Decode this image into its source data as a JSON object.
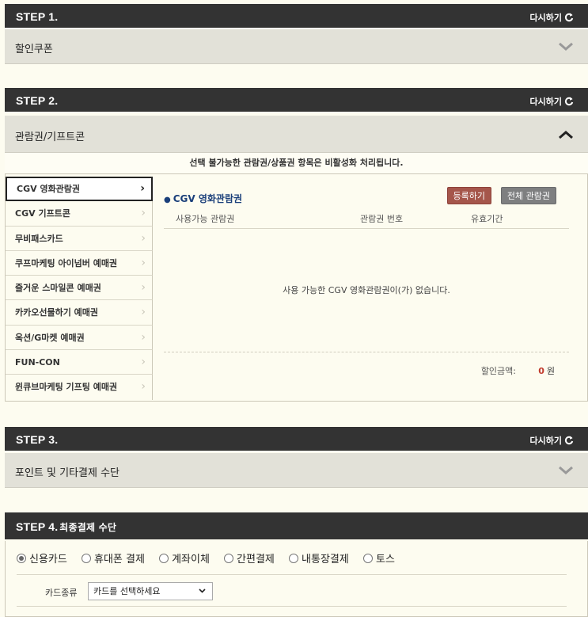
{
  "reset_label": "다시하기",
  "step1": {
    "title": "STEP 1.",
    "section_label": "할인쿠폰"
  },
  "step2": {
    "title": "STEP 2.",
    "section_label": "관람권/기프트콘",
    "notice": "선택 불가능한 관람권/상품권 항목은 비활성화 처리됩니다.",
    "sidebar": [
      {
        "label": "CGV 영화관람권",
        "active": true
      },
      {
        "label": "CGV 기프트콘",
        "active": false
      },
      {
        "label": "무비패스카드",
        "active": false
      },
      {
        "label": "쿠프마케팅 아이넘버 예매권",
        "active": false
      },
      {
        "label": "즐거운 스마일콘 예매권",
        "active": false
      },
      {
        "label": "카카오선물하기 예매권",
        "active": false
      },
      {
        "label": "옥션/G마켓 예매권",
        "active": false
      },
      {
        "label": "FUN-CON",
        "active": false
      },
      {
        "label": "윈큐브마케팅 기프팅 예매권",
        "active": false
      }
    ],
    "panel_title": "CGV 영화관람권",
    "register_button": "등록하기",
    "all_tickets_button": "전체 관람권",
    "columns": [
      "사용가능 관람권",
      "관람권 번호",
      "유효기간"
    ],
    "empty_message": "사용 가능한 CGV 영화관람권이(가) 없습니다.",
    "discount_label": "할인금액:",
    "discount_value": "0",
    "discount_unit": "원"
  },
  "step3": {
    "title": "STEP 3.",
    "section_label": "포인트 및 기타결제 수단"
  },
  "step4": {
    "title": "STEP 4.",
    "subtitle": "최종결제 수단",
    "payment_methods": [
      {
        "label": "신용카드",
        "checked": true
      },
      {
        "label": "휴대폰 결제",
        "checked": false
      },
      {
        "label": "계좌이체",
        "checked": false
      },
      {
        "label": "간편결제",
        "checked": false
      },
      {
        "label": "내통장결제",
        "checked": false
      },
      {
        "label": "토스",
        "checked": false
      }
    ],
    "card_type_label": "카드종류",
    "card_select_value": "카드를 선택하세요"
  },
  "colors": {
    "step_bar": "#333333",
    "accordion": "#e2e1d8",
    "background": "#fdfcf0",
    "panel_title": "#1a3f7a",
    "register_button": "#a5564b",
    "all_button": "#7e7f80",
    "discount_value": "#c0392b"
  },
  "icons": {
    "reset": "refresh-icon",
    "collapsed": "chevron-down-icon",
    "expanded": "chevron-up-icon",
    "list_arrow": "chevron-right-icon"
  }
}
